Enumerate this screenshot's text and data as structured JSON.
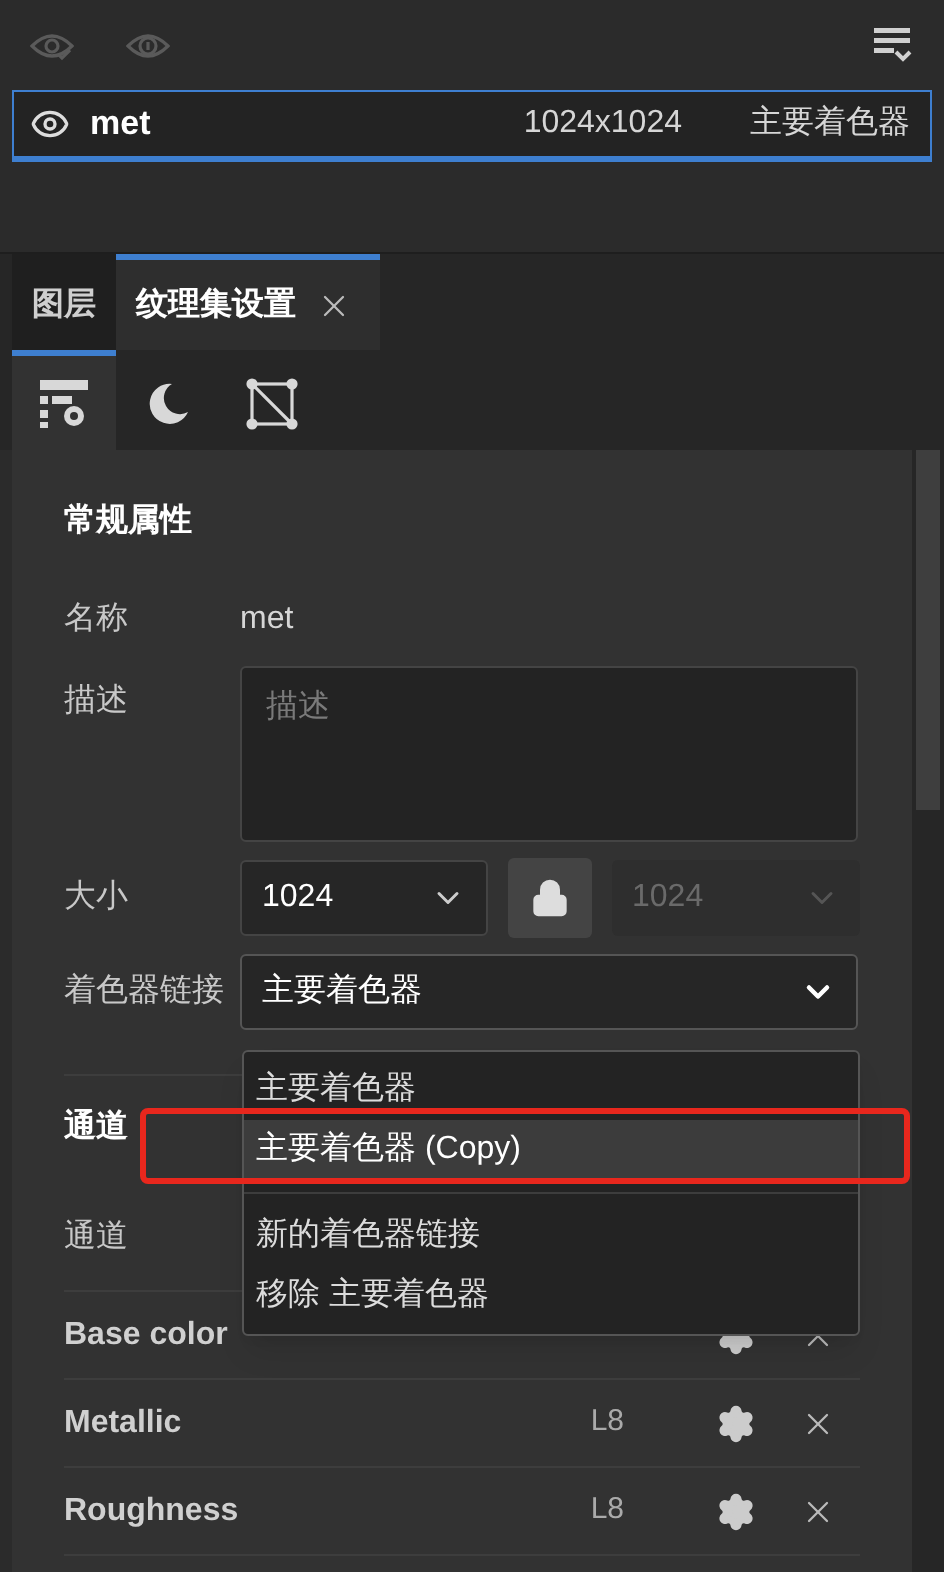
{
  "toolbar": {
    "buttons": [
      {
        "kind": "eye-check"
      },
      {
        "kind": "eye-one"
      },
      {
        "kind": "filter"
      }
    ]
  },
  "layer_row": {
    "visible": true,
    "selected": true,
    "name": "met",
    "size": "1024x1024",
    "shader": "主要着色器"
  },
  "tabs": [
    {
      "label": "图层",
      "selected": false,
      "closable": false
    },
    {
      "label": "纹理集设置",
      "selected": true,
      "closable": true
    }
  ],
  "icon_tabs": [
    {
      "kind": "settings",
      "selected": true
    },
    {
      "kind": "moon",
      "selected": false
    },
    {
      "kind": "mesh",
      "selected": false
    }
  ],
  "general": {
    "title": "常规属性",
    "name_label": "名称",
    "name_value": "met",
    "description_label": "描述",
    "description_placeholder": "描述",
    "size_label": "大小",
    "size_value": "1024",
    "locked": true,
    "size_value_2": "1024",
    "shader_label": "着色器链接",
    "shader_value": "主要着色器"
  },
  "dropdown": {
    "items": [
      {
        "label": "主要着色器",
        "hovered": false
      },
      {
        "label": "主要着色器 (Copy)",
        "hovered": true,
        "highlighted": true
      }
    ],
    "actions": [
      "新的着色器链接",
      "移除 主要着色器"
    ]
  },
  "channels": {
    "title": "通道",
    "label": "通道",
    "rows": [
      {
        "name": "Base color"
      },
      {
        "name": "Metallic",
        "format": "L8"
      },
      {
        "name": "Roughness",
        "format": "L8"
      }
    ]
  }
}
